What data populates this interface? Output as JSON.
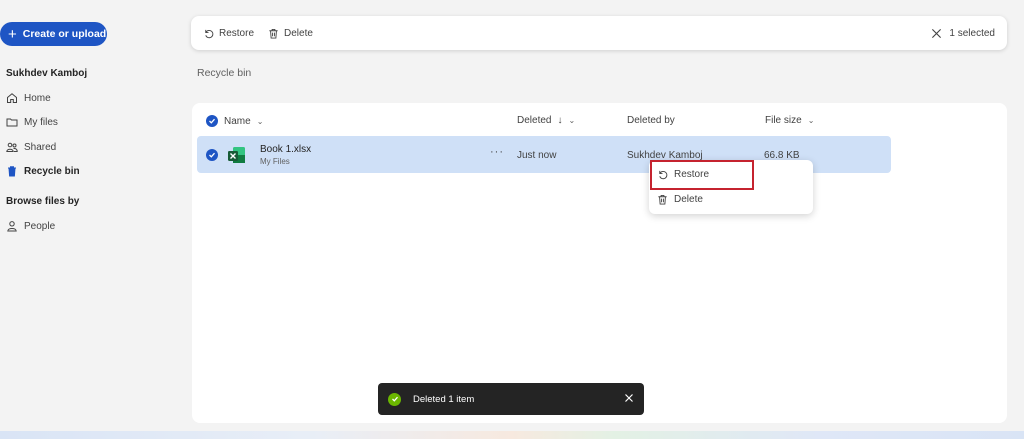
{
  "sidebar": {
    "create_label": "Create or upload",
    "owner": "Sukhdev Kamboj",
    "nav": [
      {
        "label": "Home",
        "icon": "home-icon"
      },
      {
        "label": "My files",
        "icon": "folder-icon"
      },
      {
        "label": "Shared",
        "icon": "people-icon"
      },
      {
        "label": "Recycle bin",
        "icon": "trash-icon"
      }
    ],
    "browse_heading": "Browse files by",
    "browse_items": [
      {
        "label": "People",
        "icon": "person-icon"
      }
    ]
  },
  "commandbar": {
    "restore_label": "Restore",
    "delete_label": "Delete",
    "selection_label": "1 selected"
  },
  "page": {
    "title": "Recycle bin"
  },
  "table": {
    "columns": {
      "name": "Name",
      "deleted": "Deleted",
      "deleted_sort_indicator": "↓",
      "deleted_by": "Deleted by",
      "file_size": "File size"
    },
    "rows": [
      {
        "name": "Book 1.xlsx",
        "location": "My Files",
        "more": "···",
        "deleted": "Just now",
        "deleted_by": "Sukhdev Kamboj",
        "file_size": "66.8 KB",
        "selected": true,
        "icon": "excel-file-icon"
      }
    ]
  },
  "context_menu": {
    "restore_label": "Restore",
    "delete_label": "Delete"
  },
  "toast": {
    "message": "Deleted 1 item"
  },
  "colors": {
    "accent": "#1e55c4",
    "selected_row": "#cfe0f7",
    "highlight": "#c5232f",
    "success": "#6bb700"
  }
}
